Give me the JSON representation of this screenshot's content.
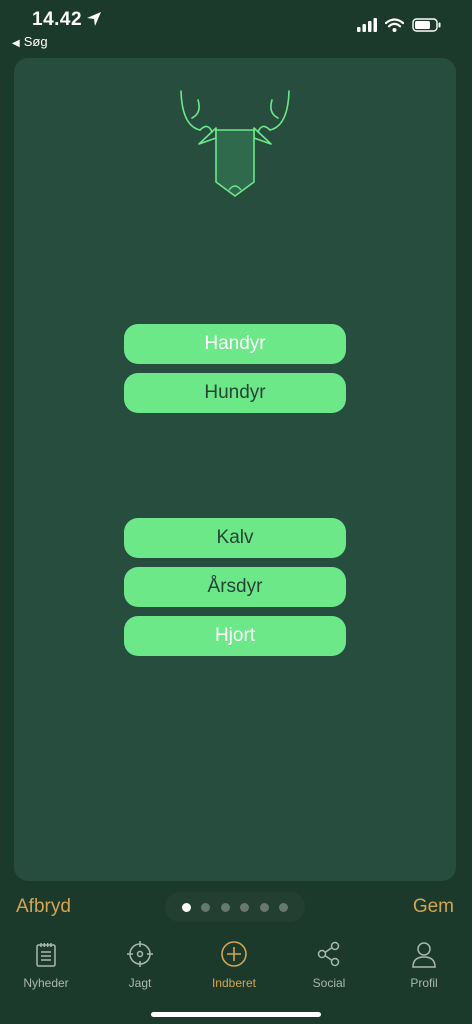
{
  "status": {
    "time": "14.42",
    "back_label": "Søg",
    "icons": [
      "location-arrow-icon",
      "cellular-signal-icon",
      "wifi-icon",
      "battery-icon"
    ]
  },
  "header": {
    "logo": "deer-head-icon"
  },
  "gender_options": [
    {
      "label": "Handyr",
      "selected": true
    },
    {
      "label": "Hundyr",
      "selected": false
    }
  ],
  "age_options": [
    {
      "label": "Kalv",
      "selected": false
    },
    {
      "label": "Årsdyr",
      "selected": false
    },
    {
      "label": "Hjort",
      "selected": true
    }
  ],
  "footer": {
    "cancel_label": "Afbryd",
    "save_label": "Gem",
    "pager": {
      "total": 6,
      "current": 1
    }
  },
  "tabs": [
    {
      "label": "Nyheder",
      "icon": "notepad-icon",
      "active": false
    },
    {
      "label": "Jagt",
      "icon": "crosshair-icon",
      "active": false
    },
    {
      "label": "Indberet",
      "icon": "plus-circle-icon",
      "active": true
    },
    {
      "label": "Social",
      "icon": "share-icon",
      "active": false
    },
    {
      "label": "Profil",
      "icon": "person-icon",
      "active": false
    }
  ],
  "colors": {
    "background": "#1c3a2c",
    "card": "#274d3e",
    "button": "#6de888",
    "accent": "#d3a453"
  }
}
